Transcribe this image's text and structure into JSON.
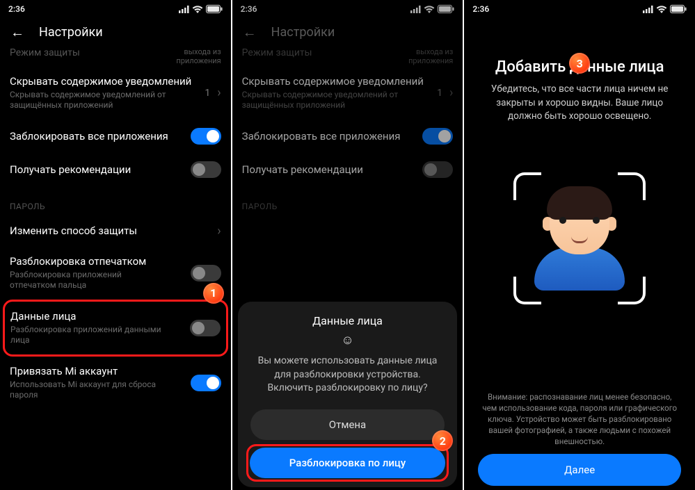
{
  "status": {
    "time": "2:36"
  },
  "header": {
    "title": "Настройки"
  },
  "top": {
    "left": "Режим защиты",
    "right": "выхода из\nприложения"
  },
  "items": {
    "hide": {
      "label": "Скрывать содержимое уведомлений",
      "sub": "Скрывать содержимое уведомлений от защищённых приложений",
      "value": "1"
    },
    "lockall": {
      "label": "Заблокировать все приложения"
    },
    "recs": {
      "label": "Получать рекомендации"
    },
    "section_pw": "ПАРОЛЬ",
    "change": {
      "label": "Изменить способ защиты"
    },
    "finger": {
      "label": "Разблокировка отпечатком",
      "sub": "Разблокировка приложений отпечатком пальца"
    },
    "face": {
      "label": "Данные лица",
      "sub": "Разблокировка приложений данными лица"
    },
    "mi": {
      "label": "Привязать Mi аккаунт",
      "sub": "Использовать Mi аккаунт для сброса пароля"
    }
  },
  "dialog": {
    "title": "Данные лица",
    "body": "Вы можете использовать данные лица для разблокировки устройства. Включить разблокировку по лицу?",
    "cancel": "Отмена",
    "confirm": "Разблокировка по лицу"
  },
  "enroll": {
    "title": "Добавить данные лица",
    "desc": "Убедитесь, что все части лица ничем не закрыты и хорошо видны. Ваше лицо должно быть хорошо освещено.",
    "warn": "Внимание: распознавание лиц менее безопасно, чем использование кода, пароля или графического ключа. Устройство может быть разблокировано вашей фотографией, а также людьми с похожей внешностью.",
    "next": "Далее"
  },
  "callouts": {
    "c1": "1",
    "c2": "2",
    "c3": "3"
  }
}
